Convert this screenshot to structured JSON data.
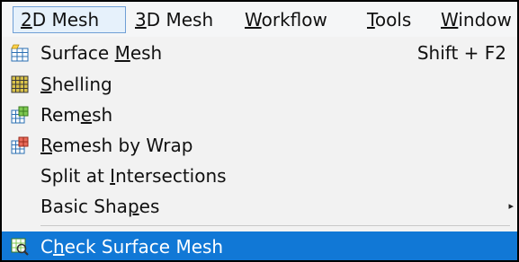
{
  "menubar": {
    "items": [
      {
        "pre": "",
        "ul": "2",
        "post": "D Mesh"
      },
      {
        "pre": "",
        "ul": "3",
        "post": "D Mesh"
      },
      {
        "pre": "",
        "ul": "W",
        "post": "orkflow"
      },
      {
        "pre": "",
        "ul": "T",
        "post": "ools"
      },
      {
        "pre": "",
        "ul": "W",
        "post": "indow"
      }
    ]
  },
  "dropdown": {
    "items": [
      {
        "pre": "Surface ",
        "ul": "M",
        "post": "esh",
        "shortcut": "Shift + F2",
        "icon": "surface-mesh-icon"
      },
      {
        "pre": "",
        "ul": "S",
        "post": "helling",
        "icon": "shelling-icon"
      },
      {
        "pre": "Rem",
        "ul": "e",
        "post": "sh",
        "icon": "remesh-icon"
      },
      {
        "pre": "",
        "ul": "R",
        "post": "emesh by Wrap",
        "icon": "remesh-by-wrap-icon"
      },
      {
        "pre": "Split at ",
        "ul": "I",
        "post": "ntersections"
      },
      {
        "pre": "Basic Sha",
        "ul": "p",
        "post": "es",
        "submenu_arrow": "▸"
      },
      {
        "pre": "C",
        "ul": "h",
        "post": "eck Surface Mesh",
        "icon": "check-surface-mesh-icon"
      }
    ]
  },
  "colors": {
    "highlight": "#1178d6",
    "menubar_active_bg": "#e6f1fb",
    "menubar_active_border": "#6f9fd6",
    "menu_bg": "#f2f2f2"
  }
}
